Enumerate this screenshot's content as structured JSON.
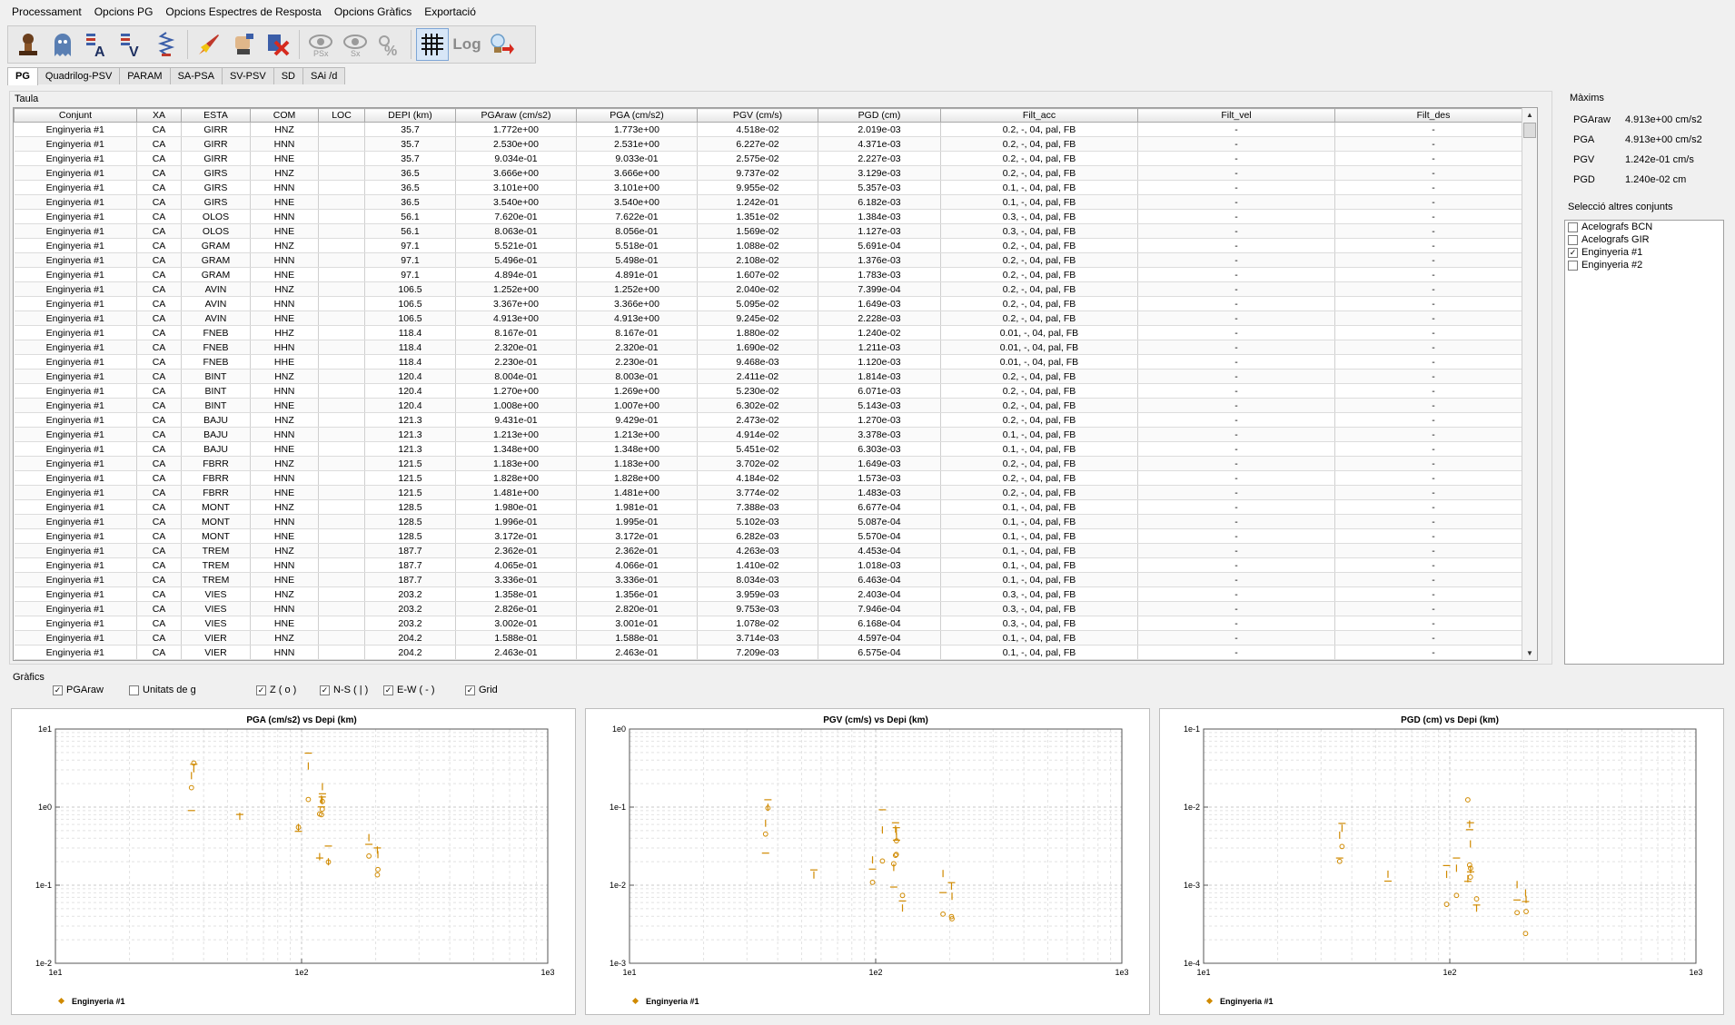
{
  "menu": [
    "Processament",
    "Opcions PG",
    "Opcions Espectres de Resposta",
    "Opcions Gràfics",
    "Exportació"
  ],
  "toolbar": [
    "stamp-icon",
    "ghost-icon",
    "spectrum-a-icon",
    "spectrum-v-icon",
    "spring-icon",
    "rocket-icon",
    "hand-stamp-icon",
    "delete-icon",
    "eye-psx-icon",
    "eye-sx-icon",
    "percent-icon",
    "grid-icon",
    "log-icon",
    "exit-icon"
  ],
  "toolbar_text": {
    "psx": "PSx",
    "sx": "Sx",
    "log": "Log"
  },
  "tabs": [
    "PG",
    "Quadrilog-PSV",
    "PARAM",
    "SA-PSA",
    "SV-PSV",
    "SD",
    "SAi /d"
  ],
  "taula": {
    "label": "Taula",
    "columns": [
      "Conjunt",
      "XA",
      "ESTA",
      "COM",
      "LOC",
      "DEPI (km)",
      "PGAraw (cm/s2)",
      "PGA (cm/s2)",
      "PGV (cm/s)",
      "PGD (cm)",
      "Filt_acc",
      "Filt_vel",
      "Filt_des"
    ],
    "rows": [
      [
        "Enginyeria #1",
        "CA",
        "GIRR",
        "HNZ",
        "",
        "35.7",
        "1.772e+00",
        "1.773e+00",
        "4.518e-02",
        "2.019e-03",
        "0.2, -, 04, pal, FB",
        "-",
        "-"
      ],
      [
        "Enginyeria #1",
        "CA",
        "GIRR",
        "HNN",
        "",
        "35.7",
        "2.530e+00",
        "2.531e+00",
        "6.227e-02",
        "4.371e-03",
        "0.2, -, 04, pal, FB",
        "-",
        "-"
      ],
      [
        "Enginyeria #1",
        "CA",
        "GIRR",
        "HNE",
        "",
        "35.7",
        "9.034e-01",
        "9.033e-01",
        "2.575e-02",
        "2.227e-03",
        "0.2, -, 04, pal, FB",
        "-",
        "-"
      ],
      [
        "Enginyeria #1",
        "CA",
        "GIRS",
        "HNZ",
        "",
        "36.5",
        "3.666e+00",
        "3.666e+00",
        "9.737e-02",
        "3.129e-03",
        "0.2, -, 04, pal, FB",
        "-",
        "-"
      ],
      [
        "Enginyeria #1",
        "CA",
        "GIRS",
        "HNN",
        "",
        "36.5",
        "3.101e+00",
        "3.101e+00",
        "9.955e-02",
        "5.357e-03",
        "0.1, -, 04, pal, FB",
        "-",
        "-"
      ],
      [
        "Enginyeria #1",
        "CA",
        "GIRS",
        "HNE",
        "",
        "36.5",
        "3.540e+00",
        "3.540e+00",
        "1.242e-01",
        "6.182e-03",
        "0.1, -, 04, pal, FB",
        "-",
        "-"
      ],
      [
        "Enginyeria #1",
        "CA",
        "OLOS",
        "HNN",
        "",
        "56.1",
        "7.620e-01",
        "7.622e-01",
        "1.351e-02",
        "1.384e-03",
        "0.3, -, 04, pal, FB",
        "-",
        "-"
      ],
      [
        "Enginyeria #1",
        "CA",
        "OLOS",
        "HNE",
        "",
        "56.1",
        "8.063e-01",
        "8.056e-01",
        "1.569e-02",
        "1.127e-03",
        "0.3, -, 04, pal, FB",
        "-",
        "-"
      ],
      [
        "Enginyeria #1",
        "CA",
        "GRAM",
        "HNZ",
        "",
        "97.1",
        "5.521e-01",
        "5.518e-01",
        "1.088e-02",
        "5.691e-04",
        "0.2, -, 04, pal, FB",
        "-",
        "-"
      ],
      [
        "Enginyeria #1",
        "CA",
        "GRAM",
        "HNN",
        "",
        "97.1",
        "5.496e-01",
        "5.498e-01",
        "2.108e-02",
        "1.376e-03",
        "0.2, -, 04, pal, FB",
        "-",
        "-"
      ],
      [
        "Enginyeria #1",
        "CA",
        "GRAM",
        "HNE",
        "",
        "97.1",
        "4.894e-01",
        "4.891e-01",
        "1.607e-02",
        "1.783e-03",
        "0.2, -, 04, pal, FB",
        "-",
        "-"
      ],
      [
        "Enginyeria #1",
        "CA",
        "AVIN",
        "HNZ",
        "",
        "106.5",
        "1.252e+00",
        "1.252e+00",
        "2.040e-02",
        "7.399e-04",
        "0.2, -, 04, pal, FB",
        "-",
        "-"
      ],
      [
        "Enginyeria #1",
        "CA",
        "AVIN",
        "HNN",
        "",
        "106.5",
        "3.367e+00",
        "3.366e+00",
        "5.095e-02",
        "1.649e-03",
        "0.2, -, 04, pal, FB",
        "-",
        "-"
      ],
      [
        "Enginyeria #1",
        "CA",
        "AVIN",
        "HNE",
        "",
        "106.5",
        "4.913e+00",
        "4.913e+00",
        "9.245e-02",
        "2.228e-03",
        "0.2, -, 04, pal, FB",
        "-",
        "-"
      ],
      [
        "Enginyeria #1",
        "CA",
        "FNEB",
        "HHZ",
        "",
        "118.4",
        "8.167e-01",
        "8.167e-01",
        "1.880e-02",
        "1.240e-02",
        "0.01, -, 04, pal, FB",
        "-",
        "-"
      ],
      [
        "Enginyeria #1",
        "CA",
        "FNEB",
        "HHN",
        "",
        "118.4",
        "2.320e-01",
        "2.320e-01",
        "1.690e-02",
        "1.211e-03",
        "0.01, -, 04, pal, FB",
        "-",
        "-"
      ],
      [
        "Enginyeria #1",
        "CA",
        "FNEB",
        "HHE",
        "",
        "118.4",
        "2.230e-01",
        "2.230e-01",
        "9.468e-03",
        "1.120e-03",
        "0.01, -, 04, pal, FB",
        "-",
        "-"
      ],
      [
        "Enginyeria #1",
        "CA",
        "BINT",
        "HNZ",
        "",
        "120.4",
        "8.004e-01",
        "8.003e-01",
        "2.411e-02",
        "1.814e-03",
        "0.2, -, 04, pal, FB",
        "-",
        "-"
      ],
      [
        "Enginyeria #1",
        "CA",
        "BINT",
        "HNN",
        "",
        "120.4",
        "1.270e+00",
        "1.269e+00",
        "5.230e-02",
        "6.071e-03",
        "0.2, -, 04, pal, FB",
        "-",
        "-"
      ],
      [
        "Enginyeria #1",
        "CA",
        "BINT",
        "HNE",
        "",
        "120.4",
        "1.008e+00",
        "1.007e+00",
        "6.302e-02",
        "5.143e-03",
        "0.2, -, 04, pal, FB",
        "-",
        "-"
      ],
      [
        "Enginyeria #1",
        "CA",
        "BAJU",
        "HNZ",
        "",
        "121.3",
        "9.431e-01",
        "9.429e-01",
        "2.473e-02",
        "1.270e-03",
        "0.2, -, 04, pal, FB",
        "-",
        "-"
      ],
      [
        "Enginyeria #1",
        "CA",
        "BAJU",
        "HNN",
        "",
        "121.3",
        "1.213e+00",
        "1.213e+00",
        "4.914e-02",
        "3.378e-03",
        "0.1, -, 04, pal, FB",
        "-",
        "-"
      ],
      [
        "Enginyeria #1",
        "CA",
        "BAJU",
        "HNE",
        "",
        "121.3",
        "1.348e+00",
        "1.348e+00",
        "5.451e-02",
        "6.303e-03",
        "0.1, -, 04, pal, FB",
        "-",
        "-"
      ],
      [
        "Enginyeria #1",
        "CA",
        "FBRR",
        "HNZ",
        "",
        "121.5",
        "1.183e+00",
        "1.183e+00",
        "3.702e-02",
        "1.649e-03",
        "0.2, -, 04, pal, FB",
        "-",
        "-"
      ],
      [
        "Enginyeria #1",
        "CA",
        "FBRR",
        "HNN",
        "",
        "121.5",
        "1.828e+00",
        "1.828e+00",
        "4.184e-02",
        "1.573e-03",
        "0.2, -, 04, pal, FB",
        "-",
        "-"
      ],
      [
        "Enginyeria #1",
        "CA",
        "FBRR",
        "HNE",
        "",
        "121.5",
        "1.481e+00",
        "1.481e+00",
        "3.774e-02",
        "1.483e-03",
        "0.2, -, 04, pal, FB",
        "-",
        "-"
      ],
      [
        "Enginyeria #1",
        "CA",
        "MONT",
        "HNZ",
        "",
        "128.5",
        "1.980e-01",
        "1.981e-01",
        "7.388e-03",
        "6.677e-04",
        "0.1, -, 04, pal, FB",
        "-",
        "-"
      ],
      [
        "Enginyeria #1",
        "CA",
        "MONT",
        "HNN",
        "",
        "128.5",
        "1.996e-01",
        "1.995e-01",
        "5.102e-03",
        "5.087e-04",
        "0.1, -, 04, pal, FB",
        "-",
        "-"
      ],
      [
        "Enginyeria #1",
        "CA",
        "MONT",
        "HNE",
        "",
        "128.5",
        "3.172e-01",
        "3.172e-01",
        "6.282e-03",
        "5.570e-04",
        "0.1, -, 04, pal, FB",
        "-",
        "-"
      ],
      [
        "Enginyeria #1",
        "CA",
        "TREM",
        "HNZ",
        "",
        "187.7",
        "2.362e-01",
        "2.362e-01",
        "4.263e-03",
        "4.453e-04",
        "0.1, -, 04, pal, FB",
        "-",
        "-"
      ],
      [
        "Enginyeria #1",
        "CA",
        "TREM",
        "HNN",
        "",
        "187.7",
        "4.065e-01",
        "4.066e-01",
        "1.410e-02",
        "1.018e-03",
        "0.1, -, 04, pal, FB",
        "-",
        "-"
      ],
      [
        "Enginyeria #1",
        "CA",
        "TREM",
        "HNE",
        "",
        "187.7",
        "3.336e-01",
        "3.336e-01",
        "8.034e-03",
        "6.463e-04",
        "0.1, -, 04, pal, FB",
        "-",
        "-"
      ],
      [
        "Enginyeria #1",
        "CA",
        "VIES",
        "HNZ",
        "",
        "203.2",
        "1.358e-01",
        "1.356e-01",
        "3.959e-03",
        "2.403e-04",
        "0.3, -, 04, pal, FB",
        "-",
        "-"
      ],
      [
        "Enginyeria #1",
        "CA",
        "VIES",
        "HNN",
        "",
        "203.2",
        "2.826e-01",
        "2.820e-01",
        "9.753e-03",
        "7.946e-04",
        "0.3, -, 04, pal, FB",
        "-",
        "-"
      ],
      [
        "Enginyeria #1",
        "CA",
        "VIES",
        "HNE",
        "",
        "203.2",
        "3.002e-01",
        "3.001e-01",
        "1.078e-02",
        "6.168e-04",
        "0.3, -, 04, pal, FB",
        "-",
        "-"
      ],
      [
        "Enginyeria #1",
        "CA",
        "VIER",
        "HNZ",
        "",
        "204.2",
        "1.588e-01",
        "1.588e-01",
        "3.714e-03",
        "4.597e-04",
        "0.1, -, 04, pal, FB",
        "-",
        "-"
      ],
      [
        "Enginyeria #1",
        "CA",
        "VIER",
        "HNN",
        "",
        "204.2",
        "2.463e-01",
        "2.463e-01",
        "7.209e-03",
        "6.575e-04",
        "0.1, -, 04, pal, FB",
        "-",
        "-"
      ]
    ]
  },
  "maxims": {
    "label": "Màxims",
    "items": [
      [
        "PGAraw",
        "4.913e+00 cm/s2"
      ],
      [
        "PGA",
        "4.913e+00 cm/s2"
      ],
      [
        "PGV",
        "1.242e-01 cm/s"
      ],
      [
        "PGD",
        "1.240e-02 cm"
      ]
    ]
  },
  "seleccio": {
    "label": "Selecció altres conjunts",
    "items": [
      {
        "label": "Acelografs BCN",
        "checked": false
      },
      {
        "label": "Acelografs GIR",
        "checked": false
      },
      {
        "label": "Enginyeria #1",
        "checked": true
      },
      {
        "label": "Enginyeria #2",
        "checked": false
      }
    ]
  },
  "grafics": {
    "label": "Gràfics",
    "options": [
      {
        "label": "PGAraw",
        "checked": true
      },
      {
        "label": "Unitats de g",
        "checked": false
      },
      {
        "label": "Z ( o )",
        "checked": true
      },
      {
        "label": "N-S ( | )",
        "checked": true
      },
      {
        "label": "E-W ( - )",
        "checked": true
      },
      {
        "label": "Grid",
        "checked": true
      }
    ]
  },
  "colors": {
    "series": "#d08a00"
  },
  "chart_data": [
    {
      "type": "scatter",
      "title": "PGA (cm/s2)  vs  Depi (km)",
      "xscale": "log",
      "yscale": "log",
      "xlim": [
        10,
        1000
      ],
      "ylim": [
        0.01,
        10
      ],
      "xticks": [
        "1e1",
        "1e2",
        "1e3"
      ],
      "yticks": [
        "1e-2",
        "1e-1",
        "1e0",
        "1e1"
      ],
      "legend": [
        "Enginyeria #1"
      ],
      "legend_position": "bottom-left",
      "grid": true,
      "series": [
        {
          "name": "Enginyeria #1",
          "x": [
            35.7,
            36.5,
            56.1,
            97.1,
            106.5,
            118.4,
            120.4,
            121.3,
            121.5,
            128.5,
            187.7,
            203.2,
            204.2
          ],
          "z": [
            1.773,
            3.666,
            null,
            0.5518,
            1.252,
            0.8167,
            0.8003,
            0.9429,
            1.183,
            0.1981,
            0.2362,
            0.1356,
            0.1588
          ],
          "ns": [
            2.531,
            3.101,
            0.7622,
            0.5498,
            3.366,
            0.232,
            1.269,
            1.213,
            1.828,
            0.1995,
            0.4066,
            0.282,
            0.2463
          ],
          "ew": [
            0.9033,
            3.54,
            0.8056,
            0.4891,
            4.913,
            0.223,
            1.007,
            1.348,
            1.481,
            0.3172,
            0.3336,
            0.3001,
            null
          ]
        }
      ]
    },
    {
      "type": "scatter",
      "title": "PGV (cm/s)  vs  Depi (km)",
      "xscale": "log",
      "yscale": "log",
      "xlim": [
        10,
        1000
      ],
      "ylim": [
        0.001,
        1
      ],
      "xticks": [
        "1e1",
        "1e2",
        "1e3"
      ],
      "yticks": [
        "1e-3",
        "1e-2",
        "1e-1",
        "1e0"
      ],
      "legend": [
        "Enginyeria #1"
      ],
      "legend_position": "bottom-left",
      "grid": true,
      "series": [
        {
          "name": "Enginyeria #1",
          "x": [
            35.7,
            36.5,
            56.1,
            97.1,
            106.5,
            118.4,
            120.4,
            121.3,
            121.5,
            128.5,
            187.7,
            203.2,
            204.2
          ],
          "z": [
            0.04518,
            0.09737,
            null,
            0.01088,
            0.0204,
            0.0188,
            0.02411,
            0.02473,
            0.03702,
            0.007388,
            0.004263,
            0.003959,
            0.003714
          ],
          "ns": [
            0.06227,
            0.09955,
            0.01351,
            0.02108,
            0.05095,
            0.0169,
            0.0523,
            0.04914,
            0.04184,
            0.005102,
            0.0141,
            0.009753,
            0.007209
          ],
          "ew": [
            0.02575,
            0.1242,
            0.01569,
            0.01607,
            0.09245,
            0.009468,
            0.06302,
            0.05451,
            0.03774,
            0.006282,
            0.008034,
            0.01078,
            null
          ]
        }
      ]
    },
    {
      "type": "scatter",
      "title": "PGD (cm)  vs  Depi (km)",
      "xscale": "log",
      "yscale": "log",
      "xlim": [
        10,
        1000
      ],
      "ylim": [
        0.0001,
        0.1
      ],
      "xticks": [
        "1e1",
        "1e2",
        "1e3"
      ],
      "yticks": [
        "1e-4",
        "1e-3",
        "1e-2",
        "1e-1"
      ],
      "legend": [
        "Enginyeria #1"
      ],
      "legend_position": "bottom-left",
      "grid": true,
      "series": [
        {
          "name": "Enginyeria #1",
          "x": [
            35.7,
            36.5,
            56.1,
            97.1,
            106.5,
            118.4,
            120.4,
            121.3,
            121.5,
            128.5,
            187.7,
            203.2,
            204.2
          ],
          "z": [
            0.002019,
            0.003129,
            null,
            0.0005691,
            0.0007399,
            0.0124,
            0.001814,
            0.00127,
            0.001649,
            0.0006677,
            0.0004453,
            0.0002403,
            0.0004597
          ],
          "ns": [
            0.004371,
            0.005357,
            0.001384,
            0.001376,
            0.001649,
            0.001211,
            0.006071,
            0.003378,
            0.001573,
            0.0005087,
            0.001018,
            0.0007946,
            0.0006575
          ],
          "ew": [
            0.002227,
            0.006182,
            0.001127,
            0.001783,
            0.002228,
            0.00112,
            0.005143,
            0.006303,
            0.001483,
            0.000557,
            0.0006463,
            0.0006168,
            null
          ]
        }
      ]
    }
  ]
}
